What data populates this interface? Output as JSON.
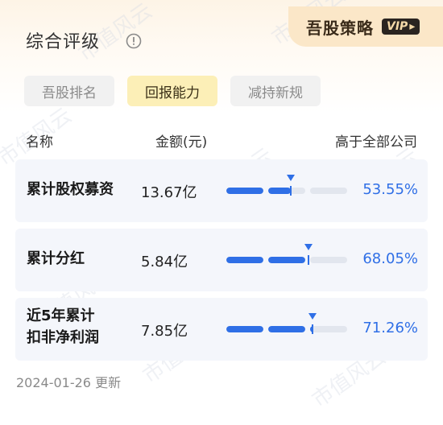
{
  "header": {
    "title": "综合评级",
    "badge_text": "吾股策略",
    "vip_label": "VIP"
  },
  "tabs": [
    {
      "label": "吾股排名",
      "active": false
    },
    {
      "label": "回报能力",
      "active": true
    },
    {
      "label": "减持新规",
      "active": false
    }
  ],
  "table": {
    "columns": [
      "名称",
      "金额(元)",
      "高于全部公司"
    ],
    "rows": [
      {
        "label_lines": [
          "累计股权募资"
        ],
        "amount": "13.67亿",
        "percent_text": "53.55%",
        "percent": 0.5355
      },
      {
        "label_lines": [
          "累计分红"
        ],
        "amount": "5.84亿",
        "percent_text": "68.05%",
        "percent": 0.6805
      },
      {
        "label_lines": [
          "近5年累计",
          "扣非净利润"
        ],
        "amount": "7.85亿",
        "percent_text": "71.26%",
        "percent": 0.7126
      }
    ]
  },
  "footer": {
    "date": "2024-01-26",
    "suffix": "更新"
  },
  "watermark": "市值风云",
  "colors": {
    "accent": "#2f6fe6",
    "tab_active_bg": "#fcefb7",
    "badge_bg": "#fbe7c8",
    "row_bg": "#f4f6fb"
  }
}
